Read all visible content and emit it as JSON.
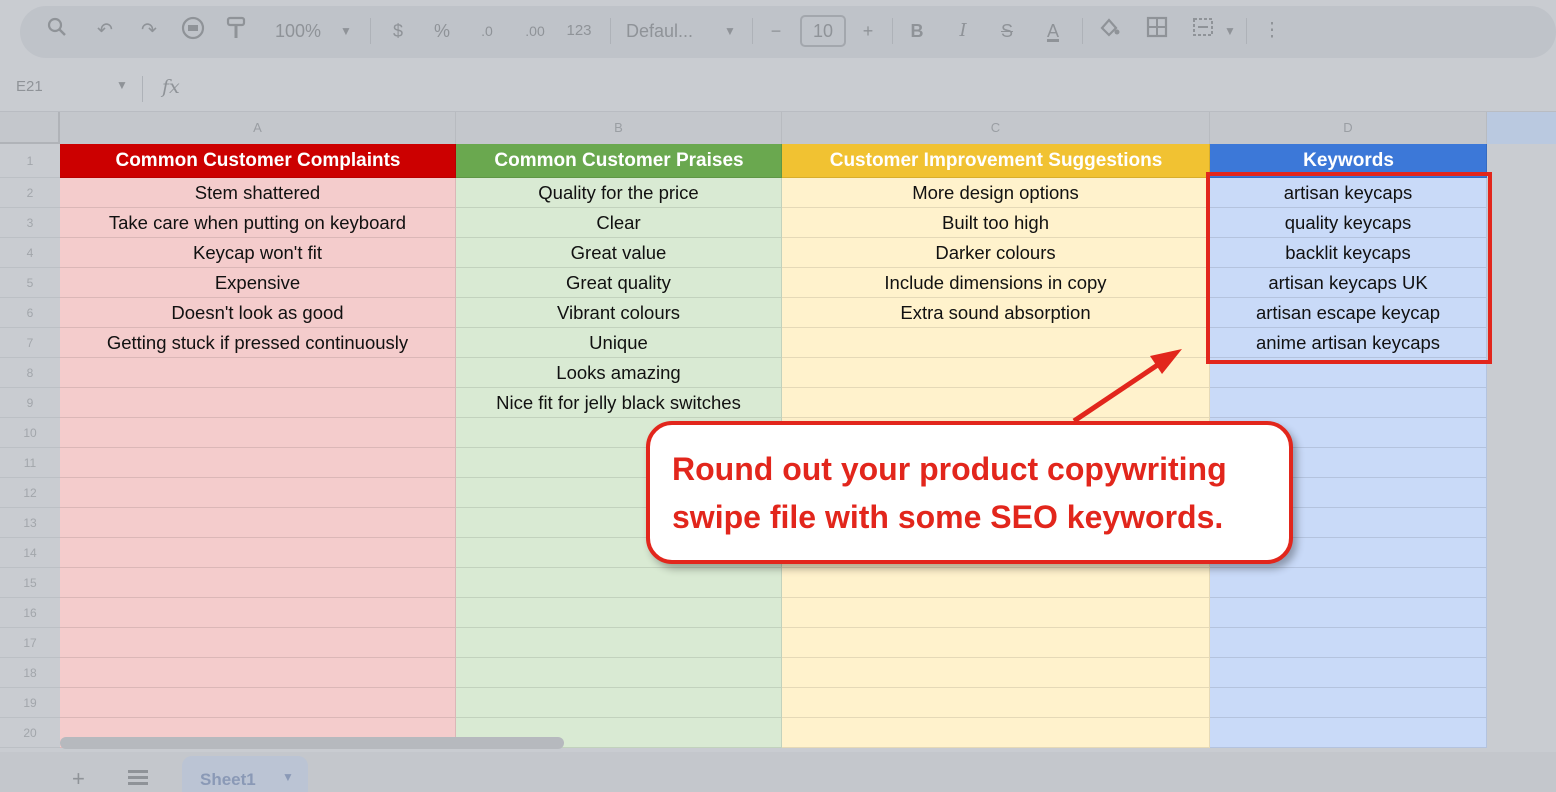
{
  "toolbar": {
    "zoom": "100%",
    "currency": "$",
    "percent": "%",
    "decimal_decrease": ".0",
    "decimal_increase": ".00",
    "number_format": "123",
    "font": "Defaul...",
    "font_size": "10",
    "bold": "B",
    "italic": "I",
    "strikethrough": "S",
    "text_color": "A",
    "minus": "−",
    "plus": "+"
  },
  "formula_bar": {
    "cell_ref": "E21",
    "fx": "fx"
  },
  "columns": [
    "A",
    "B",
    "C",
    "D"
  ],
  "rows": [
    "1",
    "2",
    "3",
    "4",
    "5",
    "6",
    "7",
    "8",
    "9",
    "10",
    "11",
    "12",
    "13",
    "14",
    "15",
    "16",
    "17",
    "18",
    "19",
    "20"
  ],
  "headers": {
    "a": "Common Customer Complaints",
    "b": "Common Customer Praises",
    "c": "Customer Improvement Suggestions",
    "d": "Keywords"
  },
  "complaints": [
    "Stem shattered",
    "Take care when putting on keyboard",
    "Keycap won't fit",
    "Expensive",
    "Doesn't look as good",
    "Getting stuck if pressed continuously"
  ],
  "praises": [
    "Quality for the price",
    "Clear",
    "Great value",
    "Great quality",
    "Vibrant colours",
    "Unique",
    "Looks amazing",
    "Nice fit for jelly black switches"
  ],
  "suggestions": [
    "More design options",
    "Built too high",
    "Darker colours",
    "Include dimensions in copy",
    "Extra sound absorption"
  ],
  "keywords": [
    "artisan keycaps",
    "quality keycaps",
    "backlit keycaps",
    "artisan keycaps UK",
    "artisan escape keycap",
    "anime artisan keycaps"
  ],
  "colors": {
    "a_header": "#cc0000",
    "b_header": "#6aa84f",
    "c_header": "#f1c232",
    "d_header": "#3c78d8",
    "a_fill": "#f4cccc",
    "b_fill": "#d9ead3",
    "c_fill": "#fff2cc",
    "d_fill": "#c9daf8",
    "callout_red": "#e2261c"
  },
  "callout": {
    "line1": "Round out your product copywriting",
    "line2": "swipe file with some SEO keywords."
  },
  "sheet_tabs": [
    {
      "label": "Sheet1"
    }
  ]
}
